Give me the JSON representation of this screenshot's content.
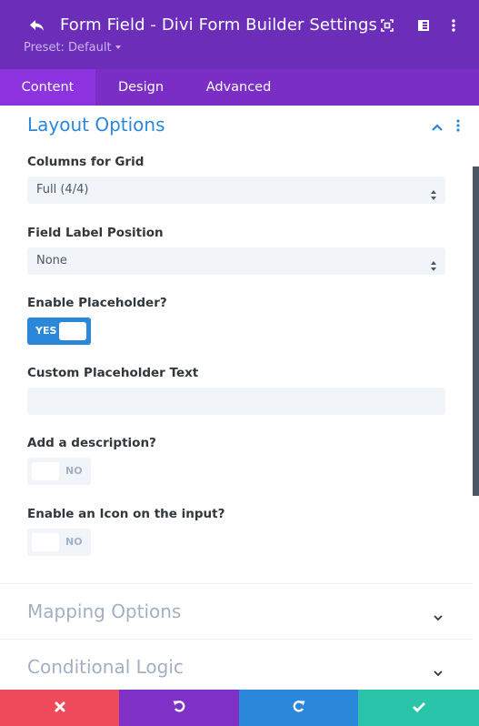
{
  "header": {
    "title": "Form Field - Divi Form Builder Settings",
    "preset_label": "Preset: Default",
    "icons": [
      "back-arrow-icon",
      "fullscreen-icon",
      "sidebar-layout-icon",
      "more-vertical-icon"
    ],
    "background_color": "#6c2eb9"
  },
  "tabs": [
    {
      "label": "Content",
      "active": true
    },
    {
      "label": "Design",
      "active": false
    },
    {
      "label": "Advanced",
      "active": false
    }
  ],
  "section": {
    "title": "Layout Options",
    "expanded": true,
    "accent_color": "#2b87da",
    "fields": {
      "columns_for_grid": {
        "label": "Columns for Grid",
        "value": "Full (4/4)"
      },
      "field_label_position": {
        "label": "Field Label Position",
        "value": "None"
      },
      "enable_placeholder": {
        "label": "Enable Placeholder?",
        "state": "YES"
      },
      "custom_placeholder_text": {
        "label": "Custom Placeholder Text",
        "value": "",
        "placeholder": ""
      },
      "add_description": {
        "label": "Add a description?",
        "state": "NO"
      },
      "enable_icon": {
        "label": "Enable an Icon on the input?",
        "state": "NO"
      }
    }
  },
  "collapsed_sections": [
    {
      "title": "Mapping Options"
    },
    {
      "title": "Conditional Logic"
    }
  ],
  "footer": {
    "buttons": [
      {
        "name": "discard",
        "icon": "close-icon",
        "color": "#ef4a5b"
      },
      {
        "name": "undo",
        "icon": "undo-icon",
        "color": "#7e30c7"
      },
      {
        "name": "redo",
        "icon": "redo-icon",
        "color": "#2b87da"
      },
      {
        "name": "save",
        "icon": "check-icon",
        "color": "#29c4a9"
      }
    ]
  }
}
